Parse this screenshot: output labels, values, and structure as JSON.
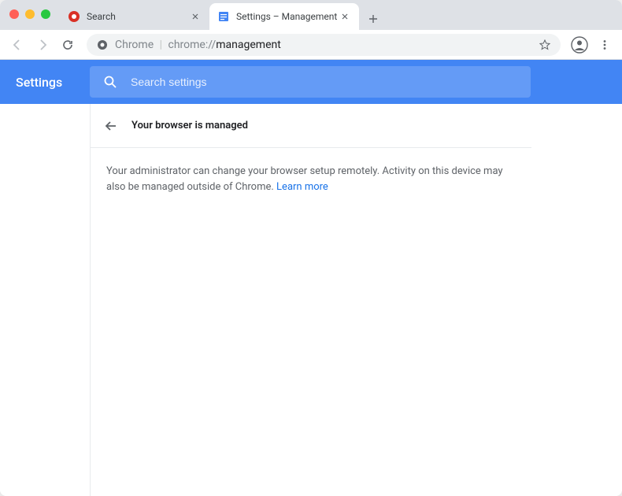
{
  "tabs": [
    {
      "title": "Search",
      "favicon_color": "#d93025"
    },
    {
      "title": "Settings – Management",
      "favicon_color": "#4285f4"
    }
  ],
  "omnibox": {
    "security_label": "Chrome",
    "url_prefix": "chrome://",
    "url_path": "management"
  },
  "settings": {
    "title": "Settings",
    "search_placeholder": "Search settings"
  },
  "page": {
    "heading": "Your browser is managed",
    "body_text": "Your administrator can change your browser setup remotely. Activity on this device may also be managed outside of Chrome. ",
    "learn_more": "Learn more"
  }
}
